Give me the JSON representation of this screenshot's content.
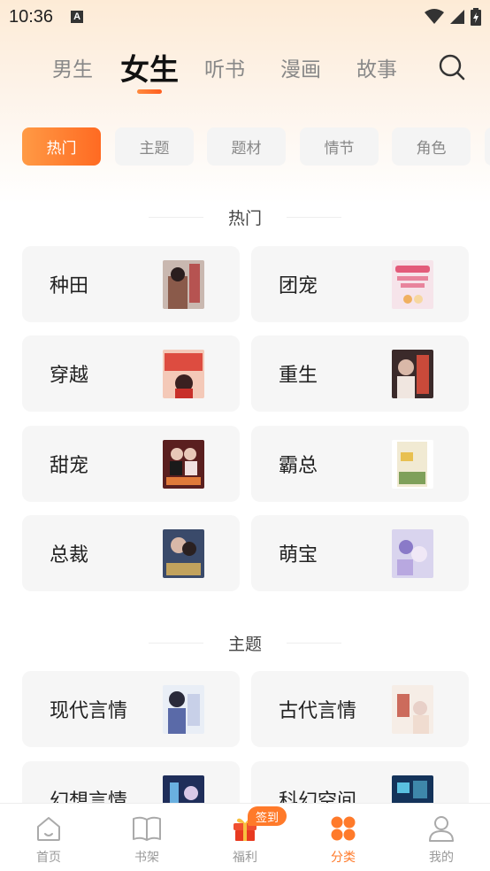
{
  "status_bar": {
    "time": "10:36",
    "notif_letter": "A"
  },
  "top_tabs": [
    {
      "label": "男生",
      "active": false
    },
    {
      "label": "女生",
      "active": true
    },
    {
      "label": "听书",
      "active": false
    },
    {
      "label": "漫画",
      "active": false
    },
    {
      "label": "故事",
      "active": false
    }
  ],
  "filters": [
    {
      "label": "热门",
      "active": true
    },
    {
      "label": "主题",
      "active": false
    },
    {
      "label": "题材",
      "active": false
    },
    {
      "label": "情节",
      "active": false
    },
    {
      "label": "角色",
      "active": false
    }
  ],
  "sections": [
    {
      "title": "热门",
      "items": [
        {
          "label": "种田",
          "cover_color": "#c9b8b0",
          "cover_accent": "#b23a3a"
        },
        {
          "label": "团宠",
          "cover_color": "#f6e4ea",
          "cover_accent": "#e35b7a"
        },
        {
          "label": "穿越",
          "cover_color": "#f4c9b8",
          "cover_accent": "#d8362a"
        },
        {
          "label": "重生",
          "cover_color": "#3b2a2a",
          "cover_accent": "#c94a3a"
        },
        {
          "label": "甜宠",
          "cover_color": "#5a1f1f",
          "cover_accent": "#e07a3a"
        },
        {
          "label": "霸总",
          "cover_color": "#f1ead3",
          "cover_accent": "#7fa05a"
        },
        {
          "label": "总裁",
          "cover_color": "#3a4a6a",
          "cover_accent": "#d9b15a"
        },
        {
          "label": "萌宝",
          "cover_color": "#d9d4ee",
          "cover_accent": "#8a7ac8"
        }
      ]
    },
    {
      "title": "主题",
      "items": [
        {
          "label": "现代言情",
          "cover_color": "#e9eef6",
          "cover_accent": "#5a6aa8"
        },
        {
          "label": "古代言情",
          "cover_color": "#f6ede6",
          "cover_accent": "#c24a3a"
        },
        {
          "label": "幻想言情",
          "cover_color": "#1f2e5a",
          "cover_accent": "#6ab0e0"
        },
        {
          "label": "科幻空间",
          "cover_color": "#14335a",
          "cover_accent": "#5ac0e0"
        }
      ]
    }
  ],
  "bottom_nav": [
    {
      "label": "首页",
      "icon": "home-icon",
      "active": false
    },
    {
      "label": "书架",
      "icon": "book-icon",
      "active": false
    },
    {
      "label": "福利",
      "icon": "gift-icon",
      "active": false
    },
    {
      "label": "分类",
      "icon": "category-icon",
      "active": true
    },
    {
      "label": "我的",
      "icon": "profile-icon",
      "active": false
    }
  ],
  "signin_badge": "签到",
  "colors": {
    "accent": "#ff7a2a",
    "accent_light": "#ff9a45",
    "muted": "#999999"
  }
}
